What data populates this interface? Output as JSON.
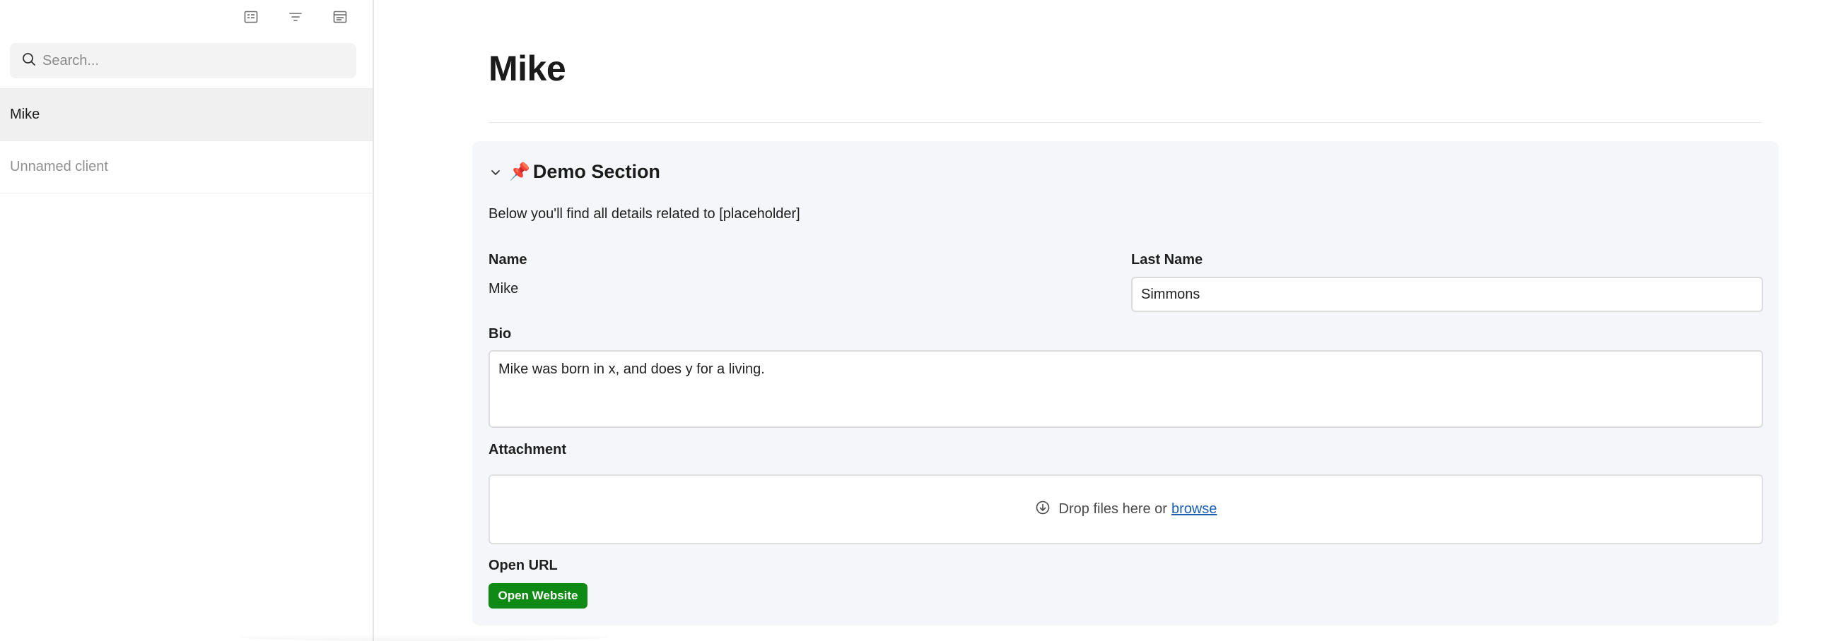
{
  "sidebar": {
    "toolbar": {
      "icons": [
        "list-view-icon",
        "filter-icon",
        "layout-icon"
      ]
    },
    "search": {
      "placeholder": "Search..."
    },
    "items": [
      {
        "label": "Mike",
        "active": true
      },
      {
        "label": "Unnamed client",
        "active": false
      }
    ]
  },
  "main": {
    "title": "Mike",
    "section": {
      "emoji": "📌",
      "title": "Demo Section",
      "description": "Below you'll find all details related to [placeholder]",
      "fields": {
        "name": {
          "label": "Name",
          "value": "Mike"
        },
        "last_name": {
          "label": "Last Name",
          "value": "Simmons"
        },
        "bio": {
          "label": "Bio",
          "value": "Mike was born in x, and does y for a living."
        },
        "attachment": {
          "label": "Attachment",
          "drop_text": "Drop files here or",
          "browse_text": "browse"
        },
        "open_url": {
          "label": "Open URL",
          "button_label": "Open Website"
        }
      }
    }
  },
  "colors": {
    "accent_green": "#0f8a14",
    "link_blue": "#1a5fb4",
    "section_bg": "#f5f6f9",
    "active_item_bg": "#f0f0f0"
  }
}
